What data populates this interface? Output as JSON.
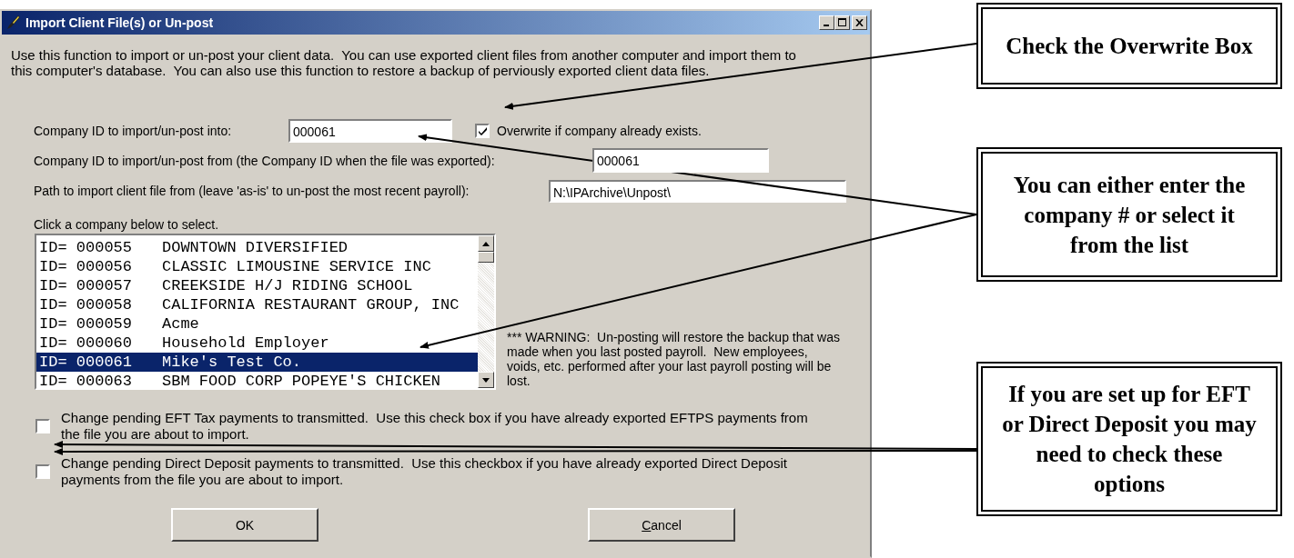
{
  "window": {
    "title": "Import Client File(s) or Un-post"
  },
  "intro": "Use this function to import or un-post your client data.  You can use exported client files from another computer and import them to this computer's database.  You can also use this function to restore a backup of perviously exported client data files.",
  "company_into": {
    "label": "Company ID to import/un-post into:",
    "value": "000061"
  },
  "overwrite": {
    "label": "Overwrite if company already exists.",
    "checked": true
  },
  "company_from": {
    "label": "Company ID to import/un-post from (the Company ID when the file was exported):",
    "value": "000061"
  },
  "path": {
    "label": "Path to import client file from (leave 'as-is' to un-post the most recent payroll):",
    "value": "N:\\IPArchive\\Unpost\\"
  },
  "list_label": "Click a company below to select.",
  "companies": [
    {
      "id": "ID= 000055",
      "name": "DOWNTOWN DIVERSIFIED",
      "selected": false
    },
    {
      "id": "ID= 000056",
      "name": "CLASSIC LIMOUSINE SERVICE INC",
      "selected": false
    },
    {
      "id": "ID= 000057",
      "name": "CREEKSIDE H/J RIDING SCHOOL",
      "selected": false
    },
    {
      "id": "ID= 000058",
      "name": "CALIFORNIA RESTAURANT GROUP, INC",
      "selected": false
    },
    {
      "id": "ID= 000059",
      "name": "Acme",
      "selected": false
    },
    {
      "id": "ID= 000060",
      "name": "Household Employer",
      "selected": false
    },
    {
      "id": "ID= 000061",
      "name": "Mike's Test Co.",
      "selected": true
    },
    {
      "id": "ID= 000063",
      "name": "SBM FOOD CORP POPEYE'S CHICKEN",
      "selected": false
    }
  ],
  "warning": "*** WARNING:  Un-posting will restore the backup that was made when you last posted payroll.  New employees, voids, etc. performed after your last payroll posting will be lost.",
  "options": [
    {
      "label": "Change pending EFT Tax payments to transmitted.  Use this check box if you have already exported EFTPS payments from the file you are about to import.",
      "checked": false
    },
    {
      "label": "Change pending Direct Deposit payments to transmitted.  Use this checkbox if you have already exported Direct Deposit payments from the file you are about to import.",
      "checked": false
    }
  ],
  "buttons": [
    {
      "label": "OK",
      "underline_first": false
    },
    {
      "label": "Cancel",
      "underline_first": true
    }
  ],
  "callouts": [
    {
      "text": "Check the Overwrite Box"
    },
    {
      "text": "You can either enter the company # or select it from the list"
    },
    {
      "text": "If you are set up for EFT or Direct Deposit you may need to check these options"
    }
  ]
}
